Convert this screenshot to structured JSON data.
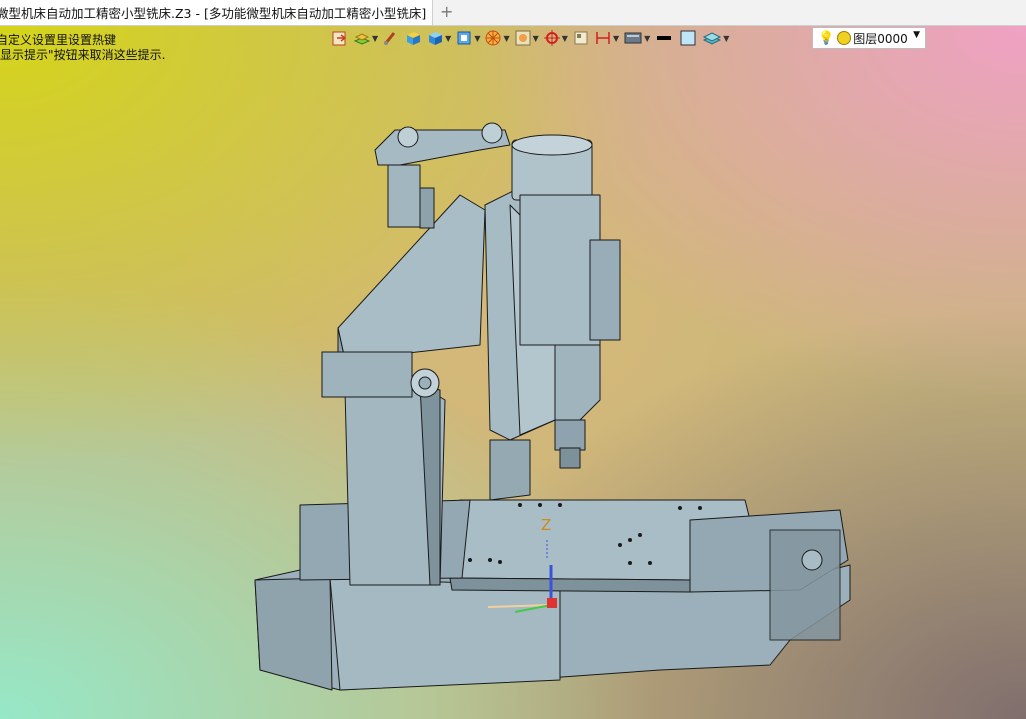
{
  "tab": {
    "title": "微型机床自动加工精密小型铣床.Z3 - [多功能微型机床自动加工精密小型铣床]",
    "close_icon": "close-icon",
    "add_icon": "plus-icon"
  },
  "hints": {
    "line1": "自定义设置里设置热键",
    "line2": "/显示提示\"按钮来取消这些提示."
  },
  "toolbar": {
    "icons": [
      "import-icon",
      "layers-move-icon",
      "brush-icon",
      "box-color-icon",
      "solid-box-icon",
      "view-cube-icon",
      "render-wheel-icon",
      "zoom-frame-icon",
      "target-icon",
      "grid-icon",
      "dimension-icon",
      "display-icon",
      "line-color-icon",
      "fill-color-icon",
      "layer-stack-icon"
    ],
    "layer_label": "图层0000"
  },
  "axis": {
    "z_label": "Z"
  },
  "colors": {
    "accent_tab": "#ffffff",
    "model_fill": "#9bb0ba",
    "model_stroke": "#1a1a1a"
  }
}
